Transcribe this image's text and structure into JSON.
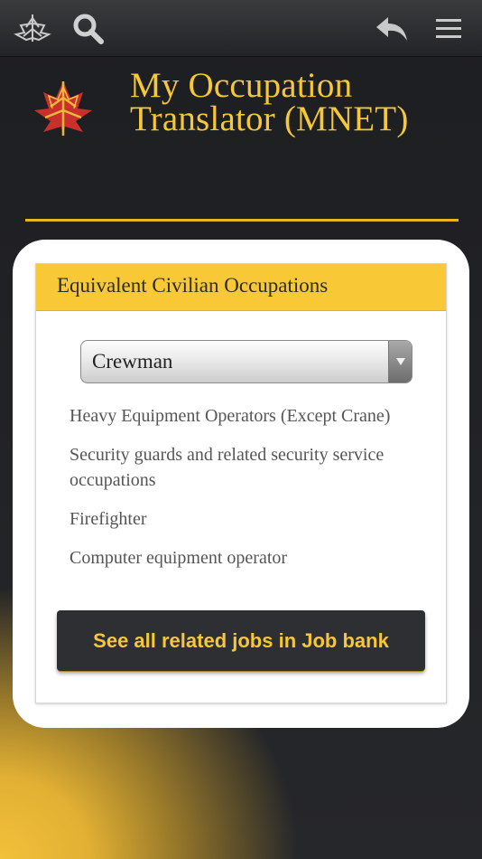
{
  "topbar": {
    "logo_icon": "maple-leaf-logo-icon",
    "search_icon": "search-icon",
    "back_icon": "reply-back-icon",
    "menu_icon": "hamburger-menu-icon"
  },
  "header": {
    "title_line1": "My Occupation",
    "title_line2": "Translator (MNET)",
    "logo_icon": "maple-leaf-emblem-icon"
  },
  "card": {
    "heading": "Equivalent Civilian Occupations",
    "select": {
      "value": "Crewman",
      "arrow_icon": "dropdown-arrow-icon"
    },
    "occupations": [
      "Heavy Equipment Operators (Except Crane)",
      "Security guards and related security service occupations",
      "Firefighter",
      "Computer equipment operator"
    ],
    "job_bank_button": "See all related jobs in Job bank"
  },
  "colors": {
    "accent_gold": "#f6c737",
    "background_dark": "#232427",
    "panel_header": "#f8c837"
  }
}
